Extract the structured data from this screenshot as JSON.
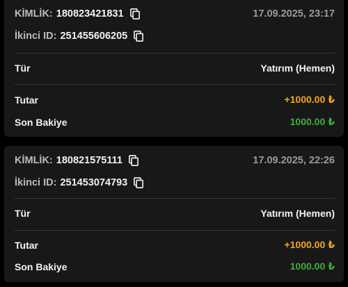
{
  "transactions": [
    {
      "id_label": "KİMLİK:",
      "id_value": "180823421831",
      "secondary_id_label": "İkinci ID:",
      "secondary_id_value": "251455606205",
      "datetime": "17.09.2025, 23:17",
      "type_label": "Tür",
      "type_value": "Yatırım (Hemen)",
      "amount_label": "Tutar",
      "amount_value": "+1000.00",
      "balance_label": "Son Bakiye",
      "balance_value": "1000.00",
      "currency_symbol": "₺"
    },
    {
      "id_label": "KİMLİK:",
      "id_value": "180821575111",
      "secondary_id_label": "İkinci ID:",
      "secondary_id_value": "251453074793",
      "datetime": "17.09.2025, 22:26",
      "type_label": "Tür",
      "type_value": "Yatırım (Hemen)",
      "amount_label": "Tutar",
      "amount_value": "+1000.00",
      "balance_label": "Son Bakiye",
      "balance_value": "1000.00",
      "currency_symbol": "₺"
    }
  ],
  "icons": {
    "copy": "copy-icon"
  },
  "colors": {
    "background": "#000000",
    "card": "#181818",
    "amount": "#f5a623",
    "balance": "#3fae3f",
    "muted": "#9a9a9a"
  }
}
